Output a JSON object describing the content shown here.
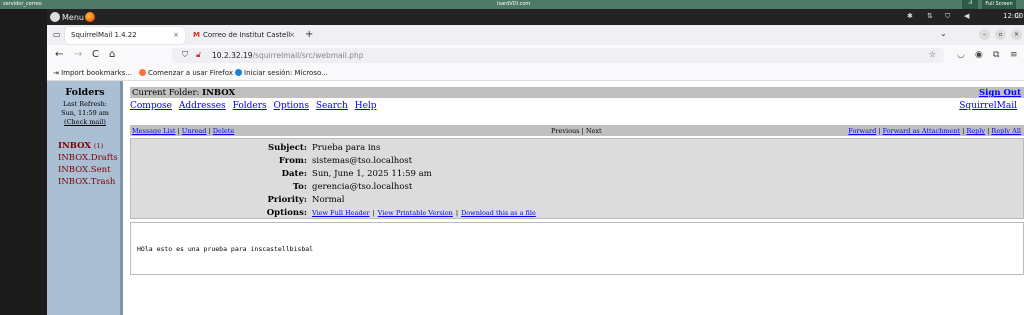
{
  "host": {
    "left_label": "servidor_correo",
    "center_label": "IsardVDI.com",
    "fullscreen": "Full Screen"
  },
  "panel": {
    "menu": "Menu",
    "clock": "12:00"
  },
  "tabs": [
    {
      "label": "SquirrelMail 1.4.22",
      "close": "×"
    },
    {
      "label": "Correo de Institut Castell",
      "close": "×"
    }
  ],
  "tabbar": {
    "new_tab": "+",
    "list": "⌄"
  },
  "window": {
    "minimize": "–",
    "restore": "▫",
    "close": "×"
  },
  "nav": {
    "back": "←",
    "forward": "→",
    "reload": "C",
    "home": "⌂"
  },
  "url": {
    "host": "10.2.32.19",
    "path": "/squirrelmail/src/webmail.php"
  },
  "bookmarks": [
    "Import bookmarks...",
    "Comenzar a usar Firefox",
    "Iniciar sesión: Microso..."
  ],
  "sidebar": {
    "title": "Folders",
    "last_refresh": "Last Refresh:",
    "refresh_time": "Sun, 11:59 am",
    "check_mail": "(Check mail)",
    "folders": [
      {
        "name": "INBOX",
        "count": "(1)"
      },
      {
        "name": "INBOX.Drafts"
      },
      {
        "name": "INBOX.Sent"
      },
      {
        "name": "INBOX.Trash"
      }
    ]
  },
  "main": {
    "current_folder_label": "Current Folder:",
    "current_folder": "INBOX",
    "sign_out": "Sign Out",
    "links": [
      "Compose",
      "Addresses",
      "Folders",
      "Options",
      "Search",
      "Help"
    ],
    "brand": "SquirrelMail",
    "msgbar": {
      "left": [
        "Message List",
        "Unread",
        "Delete"
      ],
      "prev": "Previous",
      "next": "Next",
      "right": [
        "Forward",
        "Forward as Attachment",
        "Reply",
        "Reply All"
      ]
    },
    "headers": [
      {
        "key": "Subject:",
        "value": "Prueba para ins"
      },
      {
        "key": "From:",
        "value": "sistemas@tso.localhost"
      },
      {
        "key": "Date:",
        "value": "Sun, June 1, 2025 11:59 am"
      },
      {
        "key": "To:",
        "value": "gerencia@tso.localhost"
      },
      {
        "key": "Priority:",
        "value": "Normal"
      }
    ],
    "options_key": "Options:",
    "options": [
      "View Full Header",
      "View Printable Version",
      "Download this as a file"
    ],
    "body": "HOla esto es una prueba para inscastellbisbal"
  }
}
